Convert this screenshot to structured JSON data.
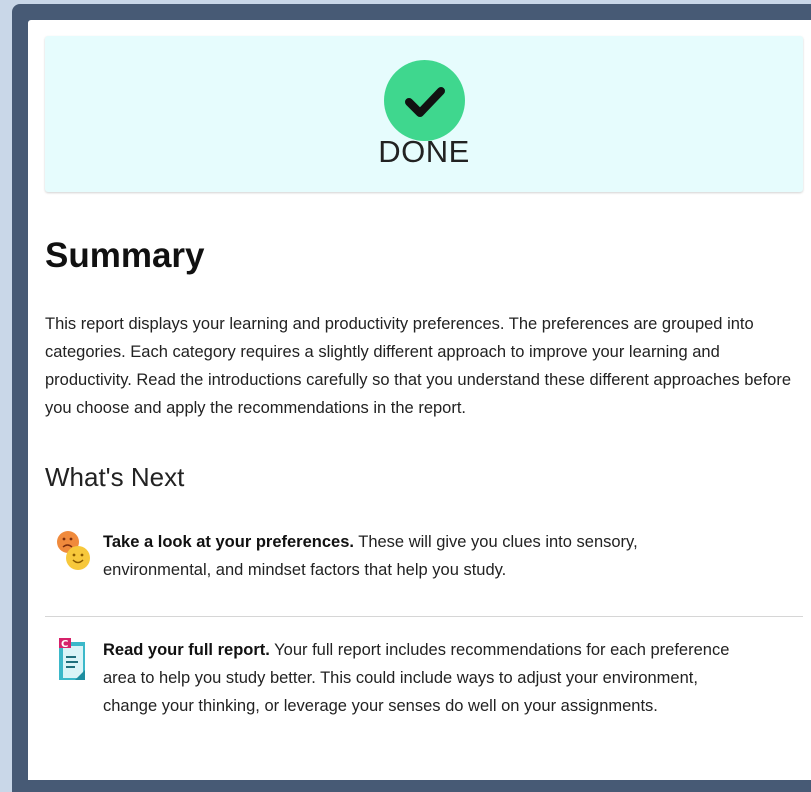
{
  "banner": {
    "status_label": "DONE",
    "check_color": "#3fd78e",
    "background": "#e6fcfd"
  },
  "summary": {
    "title": "Summary",
    "text": "This report displays your learning and productivity preferences. The preferences are grouped into categories. Each category requires a slightly different approach to improve your learning and productivity. Read the introductions carefully so that you understand these different approaches before you choose and apply the recommendations in the report."
  },
  "whats_next": {
    "title": "What's Next",
    "items": [
      {
        "icon": "emoji-faces-icon",
        "heading": "Take a look at your preferences.",
        "body": " These will give you clues into sensory, environmental, and mindset factors that help you study."
      },
      {
        "icon": "report-document-icon",
        "heading": "Read your full report.",
        "body": " Your full report includes recommendations for each preference area to help you study better. This could include ways to adjust your environment, change your thinking, or leverage your senses do well on your assignments."
      }
    ]
  },
  "colors": {
    "frame": "#475a75",
    "outer_background": "#c9d7e8"
  }
}
